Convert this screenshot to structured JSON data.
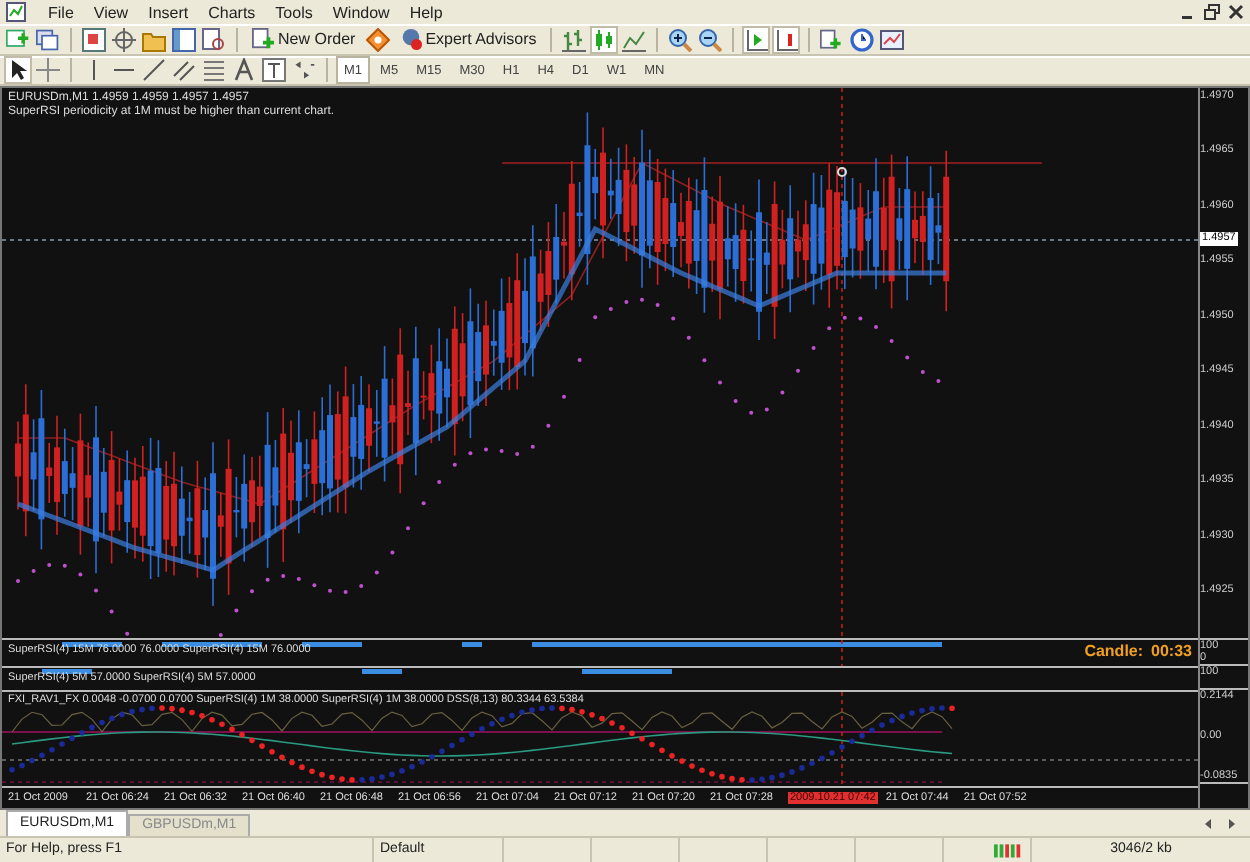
{
  "menu": [
    "File",
    "View",
    "Insert",
    "Charts",
    "Tools",
    "Window",
    "Help"
  ],
  "toolbar": {
    "new_order": "New Order",
    "expert_advisors": "Expert Advisors"
  },
  "timeframes": [
    {
      "label": "M1",
      "selected": true
    },
    {
      "label": "M5",
      "selected": false
    },
    {
      "label": "M15",
      "selected": false
    },
    {
      "label": "M30",
      "selected": false
    },
    {
      "label": "H1",
      "selected": false
    },
    {
      "label": "H4",
      "selected": false
    },
    {
      "label": "D1",
      "selected": false
    },
    {
      "label": "W1",
      "selected": false
    },
    {
      "label": "MN",
      "selected": false
    }
  ],
  "chart": {
    "symbol_line": "EURUSDm,M1  1.4959 1.4959 1.4957 1.4957",
    "message": "SuperRSI periodicity at 1M must be higher than current chart.",
    "price_axis": [
      {
        "label": "1.4970",
        "kind": "tick"
      },
      {
        "label": "1.4965",
        "kind": "tick"
      },
      {
        "label": "1.4960",
        "kind": "tick"
      },
      {
        "label": "1.4957",
        "kind": "current"
      },
      {
        "label": "1.4955",
        "kind": "tick"
      },
      {
        "label": "1.4950",
        "kind": "tick"
      },
      {
        "label": "1.4945",
        "kind": "tick"
      },
      {
        "label": "1.4940",
        "kind": "tick"
      },
      {
        "label": "1.4935",
        "kind": "tick"
      },
      {
        "label": "1.4930",
        "kind": "tick"
      },
      {
        "label": "1.4925",
        "kind": "tick"
      }
    ]
  },
  "panels": [
    {
      "legend": "SuperRSI(4) 15M 76.0000 76.0000  SuperRSI(4) 15M 76.0000",
      "axis": [
        "100",
        "0"
      ]
    },
    {
      "legend": "SuperRSI(4) 5M 57.0000  SuperRSI(4) 5M 57.0000",
      "axis": [
        "100"
      ]
    },
    {
      "legend": "FXI_RAV1_FX 0.0048 -0.0700 0.0700  SuperRSI(4) 1M 38.0000  SuperRSI(4) 1M 38.0000  DSS(8,13) 80.3344 63.5384",
      "axis": [
        "0.2144",
        "0.00",
        "-0.0835"
      ]
    }
  ],
  "candle_timer": {
    "label": "Candle:",
    "value": "00:33"
  },
  "time_axis": [
    {
      "label": "21 Oct 2009",
      "kind": "tick"
    },
    {
      "label": "21 Oct 06:24",
      "kind": "tick"
    },
    {
      "label": "21 Oct 06:32",
      "kind": "tick"
    },
    {
      "label": "21 Oct 06:40",
      "kind": "tick"
    },
    {
      "label": "21 Oct 06:48",
      "kind": "tick"
    },
    {
      "label": "21 Oct 06:56",
      "kind": "tick"
    },
    {
      "label": "21 Oct 07:04",
      "kind": "tick"
    },
    {
      "label": "21 Oct 07:12",
      "kind": "tick"
    },
    {
      "label": "21 Oct 07:20",
      "kind": "tick"
    },
    {
      "label": "21 Oct 07:28",
      "kind": "tick"
    },
    {
      "label": "2009.10.21 07:42",
      "kind": "cursor"
    },
    {
      "label": "21 Oct 07:44",
      "kind": "tick"
    },
    {
      "label": "21 Oct 07:52",
      "kind": "tick"
    }
  ],
  "tabs": [
    {
      "label": "EURUSDm,M1",
      "selected": true
    },
    {
      "label": "GBPUSDm,M1",
      "selected": false
    }
  ],
  "status_bar": {
    "help": "For Help, press F1",
    "profile": "Default",
    "traffic": "3046/2 kb"
  }
}
